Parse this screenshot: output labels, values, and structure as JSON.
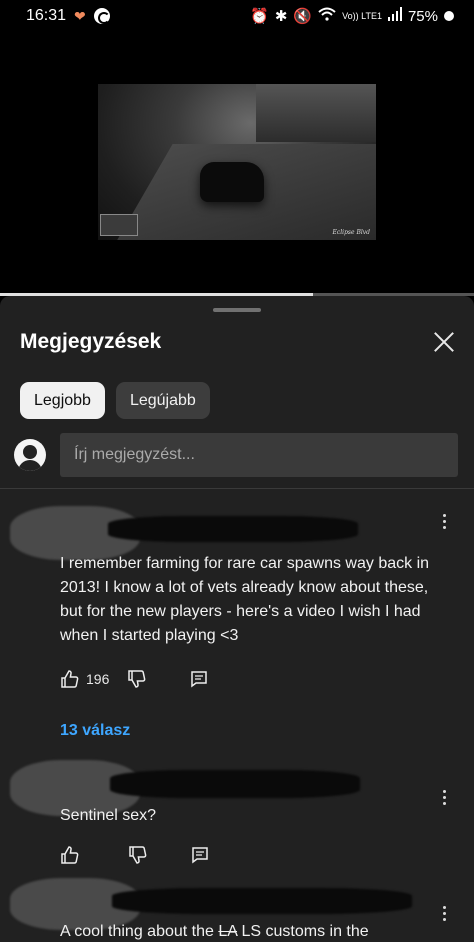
{
  "status_bar": {
    "time": "16:31",
    "network_label": "Vo)) LTE1",
    "battery": "75%"
  },
  "video": {
    "watermark": "Eclipse Blvd",
    "progress_fraction": 0.66
  },
  "comments_panel": {
    "title": "Megjegyzések",
    "close_icon": "close-icon",
    "chips": [
      "Legjobb",
      "Legújabb"
    ],
    "active_chip": "Legjobb",
    "composer_placeholder": "Írj megjegyzést...",
    "comments": [
      {
        "text": "I remember farming for rare car spawns way back in 2013! I know a lot of vets already know about these, but for the new players - here's a video I wish I had when I started playing <3",
        "likes": "196",
        "replies_label": "13 válasz"
      },
      {
        "text": "Sentinel sex?",
        "likes": ""
      },
      {
        "text_before": "A cool thing about the ",
        "text_struck": "LA",
        "text_after": "  LS customs in the"
      }
    ]
  },
  "colors": {
    "sheet_bg": "#212121",
    "link_blue": "#3ea6ff",
    "chip_active_bg": "#f1f1f1",
    "chip_inactive_bg": "#3d3d3d"
  }
}
